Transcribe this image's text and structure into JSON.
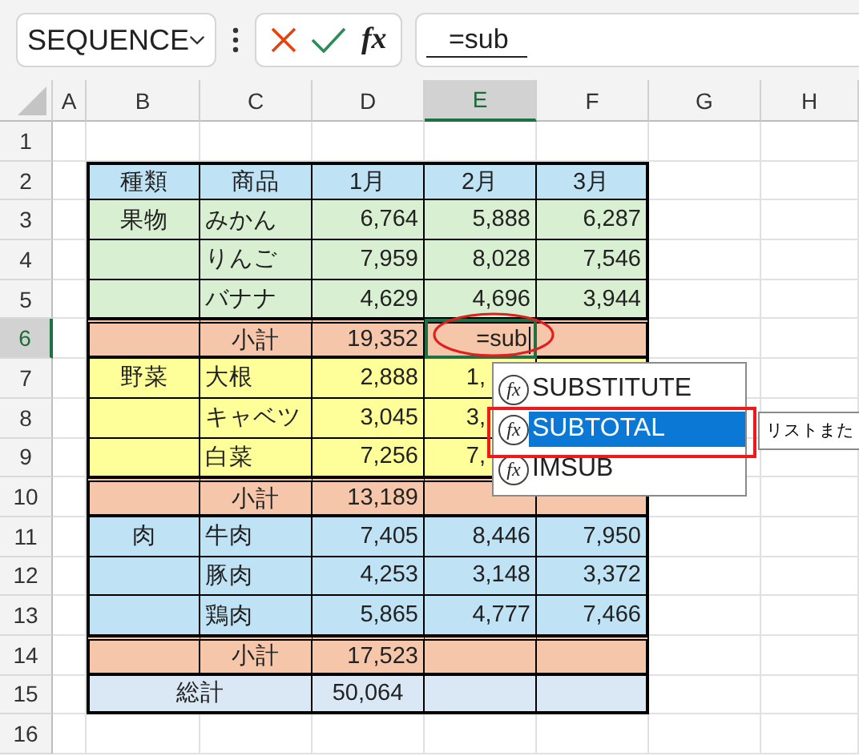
{
  "name_box": {
    "value": "SEQUENCE"
  },
  "formula_bar": {
    "cancel": true,
    "enter": true,
    "fx_label": "fx",
    "value": "=sub"
  },
  "columns": [
    {
      "label": "A",
      "selected": false
    },
    {
      "label": "B",
      "selected": false
    },
    {
      "label": "C",
      "selected": false
    },
    {
      "label": "D",
      "selected": false
    },
    {
      "label": "E",
      "selected": true
    },
    {
      "label": "F",
      "selected": false
    },
    {
      "label": "G",
      "selected": false
    },
    {
      "label": "H",
      "selected": false
    }
  ],
  "rows": [
    {
      "number": "1",
      "selected": false
    },
    {
      "number": "2",
      "selected": false,
      "kind": "header",
      "color": "#bfe2f4",
      "cells": {
        "B": "種類",
        "C": "商品",
        "D": "1月",
        "E": "2月",
        "F": "3月"
      }
    },
    {
      "number": "3",
      "selected": false,
      "kind": "item",
      "color": "#d9efd1",
      "cells": {
        "B": "果物",
        "C": "みかん",
        "D": "6,764",
        "E": "5,888",
        "F": "6,287"
      }
    },
    {
      "number": "4",
      "selected": false,
      "kind": "item",
      "color": "#d9efd1",
      "cells": {
        "C": "りんご",
        "D": "7,959",
        "E": "8,028",
        "F": "7,546"
      }
    },
    {
      "number": "5",
      "selected": false,
      "kind": "item",
      "color": "#d9efd1",
      "cells": {
        "C": "バナナ",
        "D": "4,629",
        "E": "4,696",
        "F": "3,944"
      }
    },
    {
      "number": "6",
      "selected": true,
      "kind": "subtotal",
      "color": "#f5c6aa",
      "cells": {
        "C": "小計",
        "D": "19,352",
        "E": "=sub"
      }
    },
    {
      "number": "7",
      "selected": false,
      "kind": "item",
      "color": "#ffff99",
      "under_popup": true,
      "cells": {
        "B": "野菜",
        "C": "大根",
        "D": "2,888",
        "E": "1,"
      }
    },
    {
      "number": "8",
      "selected": false,
      "kind": "item",
      "color": "#ffff99",
      "under_popup": true,
      "cells": {
        "C": "キャベツ",
        "D": "3,045",
        "E": "3,"
      }
    },
    {
      "number": "9",
      "selected": false,
      "kind": "item",
      "color": "#ffff99",
      "under_popup": true,
      "cells": {
        "C": "白菜",
        "D": "7,256",
        "E": "7,"
      }
    },
    {
      "number": "10",
      "selected": false,
      "kind": "subtotal",
      "color": "#f5c6aa",
      "cells": {
        "C": "小計",
        "D": "13,189"
      }
    },
    {
      "number": "11",
      "selected": false,
      "kind": "item",
      "color": "#bfe2f4",
      "cells": {
        "B": "肉",
        "C": "牛肉",
        "D": "7,405",
        "E": "8,446",
        "F": "7,950"
      }
    },
    {
      "number": "12",
      "selected": false,
      "kind": "item",
      "color": "#bfe2f4",
      "cells": {
        "C": "豚肉",
        "D": "4,253",
        "E": "3,148",
        "F": "3,372"
      }
    },
    {
      "number": "13",
      "selected": false,
      "kind": "item",
      "color": "#bfe2f4",
      "cells": {
        "C": "鶏肉",
        "D": "5,865",
        "E": "4,777",
        "F": "7,466"
      }
    },
    {
      "number": "14",
      "selected": false,
      "kind": "subtotal",
      "color": "#f5c6aa",
      "cells": {
        "C": "小計",
        "D": "17,523"
      }
    },
    {
      "number": "15",
      "selected": false,
      "kind": "total",
      "color": "#dae8f6",
      "cells": {
        "B": "総計",
        "D": "50,064"
      }
    },
    {
      "number": "16",
      "selected": false
    }
  ],
  "autocomplete": {
    "items": [
      {
        "icon": "fx",
        "label": "SUBSTITUTE",
        "selected": false
      },
      {
        "icon": "fx",
        "label": "SUBTOTAL",
        "selected": true
      },
      {
        "icon": "fx",
        "label": "IMSUB",
        "selected": false
      }
    ],
    "tooltip": "リストまた"
  }
}
